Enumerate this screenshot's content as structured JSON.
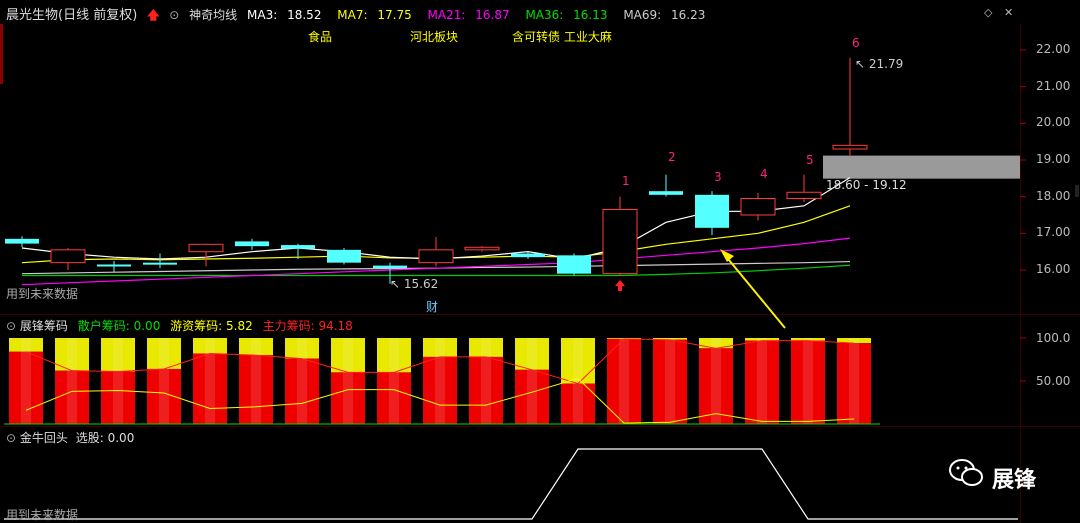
{
  "header": {
    "stock_title": "晨光生物(日线 前复权)",
    "indicator_name": "神奇均线",
    "ma3_label": "MA3:",
    "ma3_value": "18.52",
    "ma7_label": "MA7:",
    "ma7_value": "17.75",
    "ma21_label": "MA21:",
    "ma21_value": "16.87",
    "ma36_label": "MA36:",
    "ma36_value": "16.13",
    "ma69_label": "MA69:",
    "ma69_value": "16.23",
    "tags": [
      "食品",
      "河北板块",
      "含可转债 工业大麻"
    ],
    "colors": {
      "ma3": "#ffffff",
      "ma7": "#ffff00",
      "ma21": "#ff00ff",
      "ma36": "#00cc00",
      "ma69": "#cccccc"
    }
  },
  "price_panel": {
    "y_ticks": [
      "22.00",
      "21.00",
      "20.00",
      "19.00",
      "18.00",
      "17.00",
      "16.00"
    ],
    "high_annotation": "21.79",
    "low_annotation": "15.62",
    "zone_label": "18.60 - 19.12",
    "event_badge": "财",
    "future_data_label": "用到未来数据",
    "count_labels": [
      "1",
      "2",
      "3",
      "4",
      "5",
      "6"
    ]
  },
  "chip_panel": {
    "name": "展锋筹码",
    "retail_label": "散户筹码:",
    "retail_value": "0.00",
    "hot_label": "游资筹码:",
    "hot_value": "5.82",
    "main_label": "主力筹码:",
    "main_value": "94.18",
    "y_ticks": [
      "100.0",
      "50.00"
    ]
  },
  "bull_panel": {
    "name": "金牛回头",
    "select_label": "选股:",
    "select_value": "0.00",
    "future_data_label": "用到未来数据"
  },
  "watermark": {
    "brand": "展锋"
  },
  "chart_data": {
    "type": "candlestick",
    "candles": [
      {
        "open": 16.85,
        "close": 16.72,
        "high": 16.92,
        "low": 16.62
      },
      {
        "open": 16.2,
        "close": 16.55,
        "high": 16.6,
        "low": 16.0
      },
      {
        "open": 16.15,
        "close": 16.1,
        "high": 16.25,
        "low": 15.95
      },
      {
        "open": 16.2,
        "close": 16.15,
        "high": 16.45,
        "low": 16.05
      },
      {
        "open": 16.5,
        "close": 16.7,
        "high": 16.72,
        "low": 16.1
      },
      {
        "open": 16.78,
        "close": 16.65,
        "high": 16.85,
        "low": 16.55
      },
      {
        "open": 16.68,
        "close": 16.58,
        "high": 16.72,
        "low": 16.3
      },
      {
        "open": 16.55,
        "close": 16.2,
        "high": 16.6,
        "low": 16.15
      },
      {
        "open": 16.12,
        "close": 16.05,
        "high": 16.2,
        "low": 15.62
      },
      {
        "open": 16.2,
        "close": 16.55,
        "high": 16.9,
        "low": 16.1
      },
      {
        "open": 16.55,
        "close": 16.62,
        "high": 16.65,
        "low": 16.5
      },
      {
        "open": 16.45,
        "close": 16.35,
        "high": 16.5,
        "low": 16.3
      },
      {
        "open": 16.4,
        "close": 15.9,
        "high": 16.45,
        "low": 15.85
      },
      {
        "open": 15.9,
        "close": 17.65,
        "high": 18.0,
        "low": 15.85
      },
      {
        "open": 18.15,
        "close": 18.05,
        "high": 18.6,
        "low": 18.0
      },
      {
        "open": 18.05,
        "close": 17.15,
        "high": 18.15,
        "low": 16.95
      },
      {
        "open": 17.5,
        "close": 17.95,
        "high": 18.1,
        "low": 17.35
      },
      {
        "open": 17.95,
        "close": 18.12,
        "high": 18.6,
        "low": 17.85
      },
      {
        "open": 19.3,
        "close": 19.4,
        "high": 21.79,
        "low": 19.1
      }
    ],
    "ma3": [
      16.6,
      16.45,
      16.35,
      16.3,
      16.35,
      16.5,
      16.6,
      16.5,
      16.35,
      16.3,
      16.38,
      16.5,
      16.3,
      16.6,
      17.3,
      17.6,
      17.6,
      17.75,
      18.52
    ],
    "ma7": [
      16.2,
      16.28,
      16.3,
      16.28,
      16.3,
      16.32,
      16.35,
      16.38,
      16.33,
      16.32,
      16.35,
      16.38,
      16.35,
      16.5,
      16.7,
      16.85,
      17.0,
      17.3,
      17.75
    ],
    "ma21": [
      15.6,
      15.65,
      15.7,
      15.75,
      15.8,
      15.85,
      15.9,
      15.95,
      16.0,
      16.05,
      16.1,
      16.15,
      16.2,
      16.3,
      16.4,
      16.5,
      16.6,
      16.72,
      16.87
    ],
    "ma36": [
      15.85,
      15.85,
      15.85,
      15.85,
      15.85,
      15.85,
      15.85,
      15.85,
      15.85,
      15.85,
      15.85,
      15.85,
      15.85,
      15.85,
      15.88,
      15.92,
      15.98,
      16.05,
      16.13
    ],
    "ma69": [
      15.9,
      15.92,
      15.94,
      15.96,
      15.98,
      16.0,
      16.02,
      16.03,
      16.04,
      16.05,
      16.07,
      16.08,
      16.1,
      16.12,
      16.14,
      16.16,
      16.18,
      16.2,
      16.23
    ],
    "chips_main": [
      84,
      62,
      61,
      64,
      82,
      80,
      76,
      60,
      60,
      78,
      78,
      63,
      47,
      99,
      98,
      88,
      97,
      97,
      94
    ],
    "chips_hot": [
      16,
      38,
      39,
      36,
      18,
      20,
      24,
      40,
      40,
      22,
      22,
      37,
      53,
      1,
      2,
      12,
      3,
      3,
      5.82
    ],
    "bull_signal": [
      0,
      0,
      0,
      0,
      0,
      0,
      0,
      0,
      0,
      0,
      0,
      0,
      1,
      1,
      1,
      1,
      1,
      0,
      0
    ]
  }
}
